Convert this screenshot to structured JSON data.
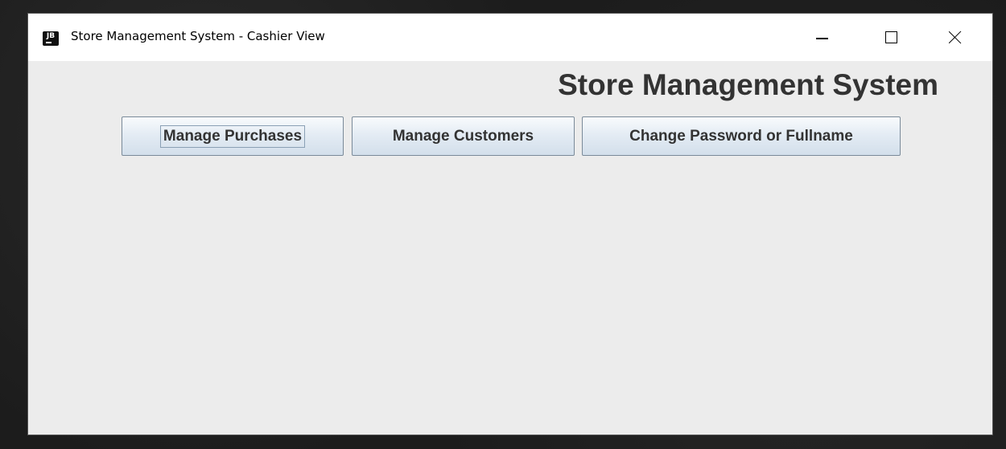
{
  "window": {
    "app_icon_text": "JB",
    "title": "Store Management System - Cashier View"
  },
  "header": {
    "title": "Store Management System"
  },
  "toolbar": {
    "manage_purchases_label": "Manage Purchases",
    "manage_customers_label": "Manage Customers",
    "change_password_label": "Change Password or Fullname"
  },
  "icons": {
    "app": "jetbrains-icon",
    "minimize": "minimize-icon",
    "maximize": "maximize-icon",
    "close": "close-icon"
  },
  "colors": {
    "window_background": "#ececec",
    "titlebar_background": "#ffffff",
    "heading_text": "#333333",
    "button_border": "#7a8a99"
  }
}
